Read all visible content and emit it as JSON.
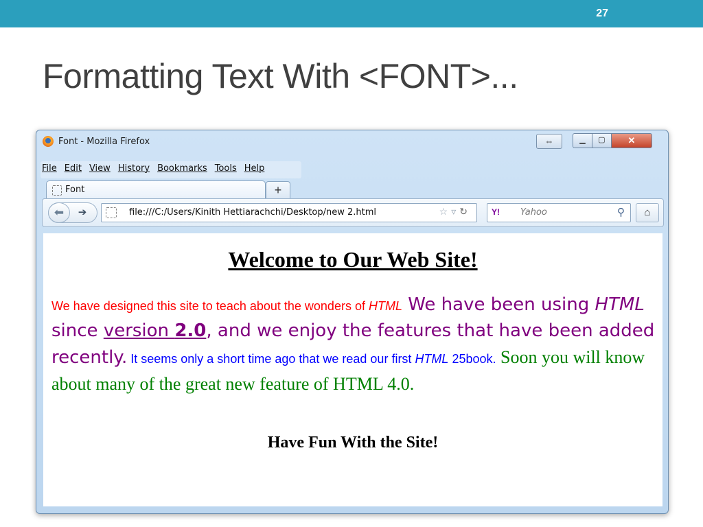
{
  "slide": {
    "number": "27",
    "title": "Formatting Text With <FONT>..."
  },
  "browser": {
    "window_title": "Font - Mozilla Firefox",
    "menu": [
      "File",
      "Edit",
      "View",
      "History",
      "Bookmarks",
      "Tools",
      "Help"
    ],
    "tab_label": "Font",
    "new_tab_label": "+",
    "url": "file:///C:/Users/Kinith Hettiarachchi/Desktop/new  2.html",
    "search_engine_badge": "Y!",
    "search_placeholder": "Yahoo",
    "icons": [
      "firefox-logo",
      "restore",
      "minimize",
      "maximize",
      "close",
      "back",
      "forward",
      "page",
      "star",
      "dropdown",
      "reload",
      "search",
      "home"
    ]
  },
  "page": {
    "heading": "Welcome to Our Web Site!",
    "red_text_1": "We have designed this site to teach about the wonders of ",
    "red_text_html": "HTML",
    "purple_text_1": " We have been using ",
    "purple_text_html": "HTML",
    "purple_text_2": " since ",
    "purple_text_version": "version ",
    "purple_text_version_num": "2.0",
    "purple_text_3": ", and we enjoy the features that have been added recently.",
    "blue_text_1": " It seems only a short time ago that we read our first ",
    "blue_text_html": "HTML",
    "blue_text_2": " 25book.",
    "green_text": " Soon you will know about many of the great new feature of HTML 4.0.",
    "footer": "Have Fun With the Site!"
  },
  "colors": {
    "slide_bar": "#2b9fbd",
    "red": "#ff0000",
    "purple": "#80007f",
    "blue": "#0000ff",
    "green": "#008000"
  }
}
